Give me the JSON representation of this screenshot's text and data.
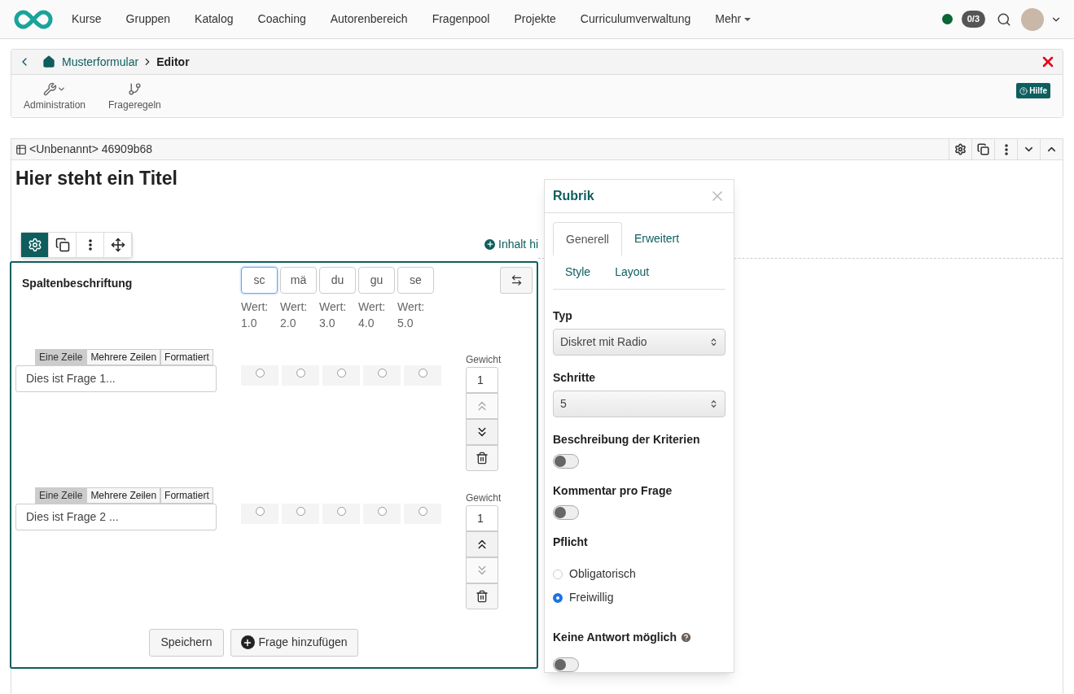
{
  "nav": {
    "items": [
      "Kurse",
      "Gruppen",
      "Katalog",
      "Coaching",
      "Autorenbereich",
      "Fragenpool",
      "Projekte",
      "Curriculumverwaltung"
    ],
    "more": "Mehr",
    "online": true,
    "badge": "0/3"
  },
  "breadcrumb": {
    "parent": "Musterformular",
    "current": "Editor"
  },
  "toolbar": [
    {
      "kind": "wrench",
      "label": "Administration",
      "dropdown": true
    },
    {
      "kind": "branch",
      "label": "Frageregeln"
    }
  ],
  "help": "Hilfe",
  "block": {
    "header": "<Unbenannt> 46909b68",
    "title": "Hier steht ein Titel",
    "add_content": "Inhalt hi"
  },
  "rubric": {
    "header_label": "Spaltenbeschriftung",
    "columns": [
      {
        "label": "sc",
        "value_label": "Wert:",
        "value": "1.0",
        "focused": true
      },
      {
        "label": "mä",
        "value_label": "Wert:",
        "value": "2.0",
        "focused": false
      },
      {
        "label": "du",
        "value_label": "Wert:",
        "value": "3.0",
        "focused": false
      },
      {
        "label": "gu",
        "value_label": "Wert:",
        "value": "4.0",
        "focused": false
      },
      {
        "label": "se",
        "value_label": "Wert:",
        "value": "5.0",
        "focused": false
      }
    ],
    "questions": [
      {
        "tabs": [
          {
            "label": "Eine Zeile",
            "selected": true
          },
          {
            "label": "Mehrere Zeilen",
            "selected": false
          },
          {
            "label": "Formatiert",
            "selected": false
          }
        ],
        "text": "Dies ist Frage 1...",
        "answers": [
          {
            "checked": false
          },
          {
            "checked": false
          },
          {
            "checked": false
          },
          {
            "checked": false
          },
          {
            "checked": false
          }
        ],
        "weight_label": "Gewicht",
        "weight": "1",
        "up_disabled": true,
        "down_disabled": false
      },
      {
        "tabs": [
          {
            "label": "Eine Zeile",
            "selected": true
          },
          {
            "label": "Mehrere Zeilen",
            "selected": false
          },
          {
            "label": "Formatiert",
            "selected": false
          }
        ],
        "text": "Dies ist Frage 2 ...",
        "answers": [
          {
            "checked": false
          },
          {
            "checked": false
          },
          {
            "checked": false
          },
          {
            "checked": false
          },
          {
            "checked": false
          }
        ],
        "weight_label": "Gewicht",
        "weight": "1",
        "up_disabled": false,
        "down_disabled": true
      }
    ],
    "save": "Speichern",
    "add": "Frage hinzufügen"
  },
  "panel": {
    "title": "Rubrik",
    "tabs": [
      {
        "label": "Generell",
        "selected": true
      },
      {
        "label": "Erweitert",
        "selected": false
      },
      {
        "label": "Style",
        "selected": false
      },
      {
        "label": "Layout",
        "selected": false
      }
    ],
    "fields": [
      {
        "kind": "select",
        "label": "Typ",
        "value": "Diskret mit Radio"
      },
      {
        "kind": "select",
        "label": "Schritte",
        "value": "5"
      },
      {
        "kind": "toggle",
        "label": "Beschreibung der Kriterien",
        "on": false
      },
      {
        "kind": "toggle",
        "label": "Kommentar pro Frage",
        "on": false
      },
      {
        "kind": "radio",
        "label": "Pflicht",
        "options": [
          {
            "label": "Obligatorisch",
            "selected": false
          },
          {
            "label": "Freiwillig",
            "selected": true
          }
        ]
      },
      {
        "kind": "toggle",
        "label": "Keine Antwort möglich",
        "on": false,
        "help": true
      }
    ]
  }
}
